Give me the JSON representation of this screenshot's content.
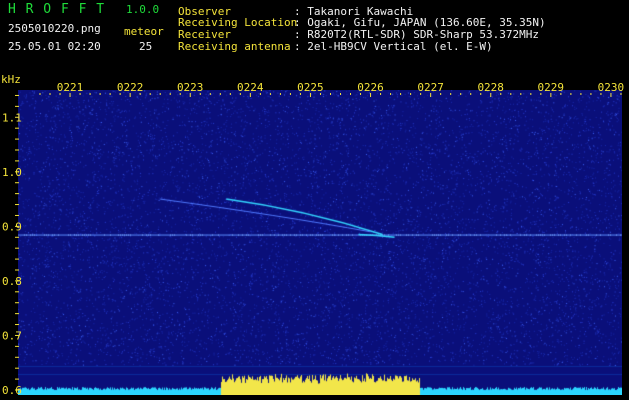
{
  "header": {
    "app_title": "H R O F F T",
    "version": "1.0.0",
    "filename": "2505010220.png",
    "meteor_label": "meteor",
    "meteor_count": "25",
    "timestamp": "25.05.01 02:20",
    "info_rows": [
      {
        "label": "Observer",
        "value": ": Takanori Kawachi"
      },
      {
        "label": "Receiving Location",
        "value": ": Ogaki, Gifu, JAPAN (136.60E, 35.35N)"
      },
      {
        "label": "Receiver",
        "value": ": R820T2(RTL-SDR) SDR-Sharp 53.372MHz"
      },
      {
        "label": "Receiving antenna",
        "value": ": 2el-HB9CV Vertical (el. E-W)"
      }
    ]
  },
  "colors": {
    "background": "#000000",
    "plot_background": "#0a0f7a",
    "title_green": "#1fdc3a",
    "label_yellow": "#f3e33a",
    "text_white": "#f2f2f2",
    "signal_cyan": "#33d6ff"
  },
  "chart_data": {
    "type": "heatmap",
    "xlabel": "",
    "ylabel": "kHz",
    "x_ticks": [
      "0221",
      "0222",
      "0223",
      "0224",
      "0225",
      "0226",
      "0227",
      "0228",
      "0229",
      "0230"
    ],
    "y_ticks": [
      "1.1",
      "1.0",
      "0.9",
      "0.8",
      "0.7",
      "0.6"
    ],
    "y_range_khz": [
      0.6,
      1.15
    ],
    "carrier_khz": 0.885,
    "meteor_trails": [
      {
        "time_start": "02:23.6",
        "time_end": "02:26.2",
        "khz_start": 0.95,
        "khz_end": 0.885
      },
      {
        "time_start": "02:25.8",
        "time_end": "02:26.4",
        "khz_start": 0.885,
        "khz_end": 0.88
      }
    ]
  }
}
